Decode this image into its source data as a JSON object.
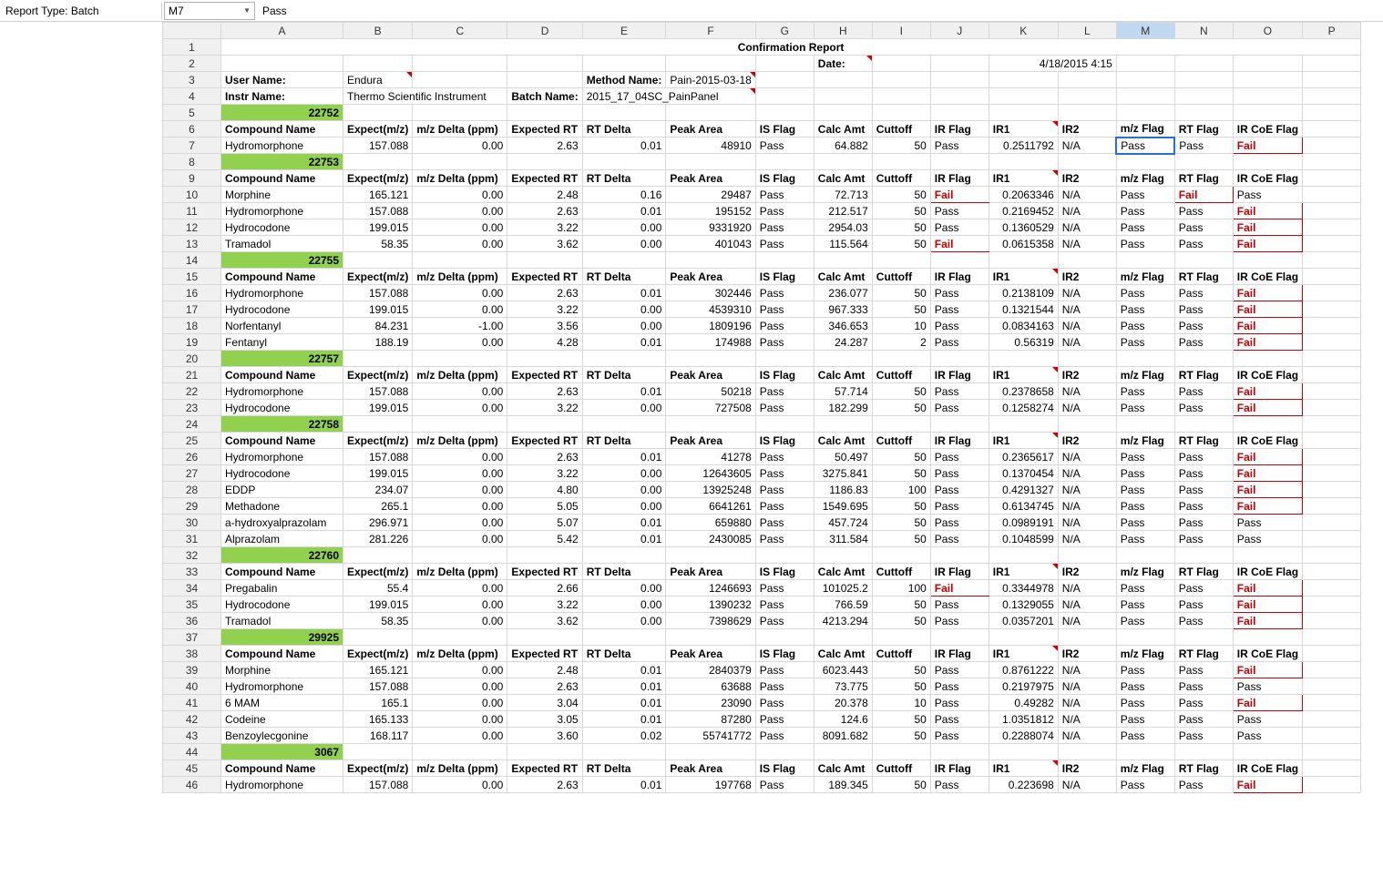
{
  "toprow": {
    "reporttype_label": "Report Type: Batch",
    "namebox": "M7",
    "formula": "Pass"
  },
  "cols": [
    "",
    "A",
    "B",
    "C",
    "D",
    "E",
    "F",
    "G",
    "H",
    "I",
    "J",
    "K",
    "L",
    "M",
    "N",
    "O",
    "P"
  ],
  "title": "Confirmation Report",
  "dateLabel": "Date:",
  "dateVal": "4/18/2015 4:15",
  "userLabel": "User Name:",
  "userVal": "Endura",
  "methodLabel": "Method Name:",
  "methodVal": "Pain-2015-03-18",
  "instrLabel": "Instr Name:",
  "instrVal": "Thermo Scientific Instrument",
  "batchLabel": "Batch Name:",
  "batchVal": "2015_17_04SC_PainPanel",
  "hdr": [
    "Compound Name",
    "Expect(m/z)",
    "m/z Delta (ppm)",
    "Expected RT",
    "RT Delta",
    "Peak Area",
    "IS Flag",
    "Calc Amt",
    "Cuttoff",
    "IR Flag",
    "IR1",
    "IR2",
    "m/z Flag",
    "RT Flag",
    "IR CoE Flag"
  ],
  "chart_data": {
    "type": "table",
    "note": "spreadsheet data rendered from groups below"
  },
  "groups": [
    {
      "id": "22752",
      "rows": [
        [
          "Hydromorphone",
          "157.088",
          "0.00",
          "2.63",
          "0.01",
          "48910",
          "Pass",
          "64.882",
          "50",
          "Pass",
          "0.2511792",
          "N/A",
          "Pass",
          "Pass",
          "Fail"
        ]
      ]
    },
    {
      "id": "22753",
      "rows": [
        [
          "Morphine",
          "165.121",
          "0.00",
          "2.48",
          "0.16",
          "29487",
          "Pass",
          "72.713",
          "50",
          "Fail",
          "0.2063346",
          "N/A",
          "Pass",
          "Fail",
          "Pass"
        ],
        [
          "Hydromorphone",
          "157.088",
          "0.00",
          "2.63",
          "0.01",
          "195152",
          "Pass",
          "212.517",
          "50",
          "Pass",
          "0.2169452",
          "N/A",
          "Pass",
          "Pass",
          "Fail"
        ],
        [
          "Hydrocodone",
          "199.015",
          "0.00",
          "3.22",
          "0.00",
          "9331920",
          "Pass",
          "2954.03",
          "50",
          "Pass",
          "0.1360529",
          "N/A",
          "Pass",
          "Pass",
          "Fail"
        ],
        [
          "Tramadol",
          "58.35",
          "0.00",
          "3.62",
          "0.00",
          "401043",
          "Pass",
          "115.564",
          "50",
          "Fail",
          "0.0615358",
          "N/A",
          "Pass",
          "Pass",
          "Fail"
        ]
      ]
    },
    {
      "id": "22755",
      "rows": [
        [
          "Hydromorphone",
          "157.088",
          "0.00",
          "2.63",
          "0.01",
          "302446",
          "Pass",
          "236.077",
          "50",
          "Pass",
          "0.2138109",
          "N/A",
          "Pass",
          "Pass",
          "Fail"
        ],
        [
          "Hydrocodone",
          "199.015",
          "0.00",
          "3.22",
          "0.00",
          "4539310",
          "Pass",
          "967.333",
          "50",
          "Pass",
          "0.1321544",
          "N/A",
          "Pass",
          "Pass",
          "Fail"
        ],
        [
          "Norfentanyl",
          "84.231",
          "-1.00",
          "3.56",
          "0.00",
          "1809196",
          "Pass",
          "346.653",
          "10",
          "Pass",
          "0.0834163",
          "N/A",
          "Pass",
          "Pass",
          "Fail"
        ],
        [
          "Fentanyl",
          "188.19",
          "0.00",
          "4.28",
          "0.01",
          "174988",
          "Pass",
          "24.287",
          "2",
          "Pass",
          "0.56319",
          "N/A",
          "Pass",
          "Pass",
          "Fail"
        ]
      ]
    },
    {
      "id": "22757",
      "rows": [
        [
          "Hydromorphone",
          "157.088",
          "0.00",
          "2.63",
          "0.01",
          "50218",
          "Pass",
          "57.714",
          "50",
          "Pass",
          "0.2378658",
          "N/A",
          "Pass",
          "Pass",
          "Fail"
        ],
        [
          "Hydrocodone",
          "199.015",
          "0.00",
          "3.22",
          "0.00",
          "727508",
          "Pass",
          "182.299",
          "50",
          "Pass",
          "0.1258274",
          "N/A",
          "Pass",
          "Pass",
          "Fail"
        ]
      ]
    },
    {
      "id": "22758",
      "rows": [
        [
          "Hydromorphone",
          "157.088",
          "0.00",
          "2.63",
          "0.01",
          "41278",
          "Pass",
          "50.497",
          "50",
          "Pass",
          "0.2365617",
          "N/A",
          "Pass",
          "Pass",
          "Fail"
        ],
        [
          "Hydrocodone",
          "199.015",
          "0.00",
          "3.22",
          "0.00",
          "12643605",
          "Pass",
          "3275.841",
          "50",
          "Pass",
          "0.1370454",
          "N/A",
          "Pass",
          "Pass",
          "Fail"
        ],
        [
          "EDDP",
          "234.07",
          "0.00",
          "4.80",
          "0.00",
          "13925248",
          "Pass",
          "1186.83",
          "100",
          "Pass",
          "0.4291327",
          "N/A",
          "Pass",
          "Pass",
          "Fail"
        ],
        [
          "Methadone",
          "265.1",
          "0.00",
          "5.05",
          "0.00",
          "6641261",
          "Pass",
          "1549.695",
          "50",
          "Pass",
          "0.6134745",
          "N/A",
          "Pass",
          "Pass",
          "Fail"
        ],
        [
          "a-hydroxyalprazolam",
          "296.971",
          "0.00",
          "5.07",
          "0.01",
          "659880",
          "Pass",
          "457.724",
          "50",
          "Pass",
          "0.0989191",
          "N/A",
          "Pass",
          "Pass",
          "Pass"
        ],
        [
          "Alprazolam",
          "281.226",
          "0.00",
          "5.42",
          "0.01",
          "2430085",
          "Pass",
          "311.584",
          "50",
          "Pass",
          "0.1048599",
          "N/A",
          "Pass",
          "Pass",
          "Pass"
        ]
      ]
    },
    {
      "id": "22760",
      "rows": [
        [
          "Pregabalin",
          "55.4",
          "0.00",
          "2.66",
          "0.00",
          "1246693",
          "Pass",
          "101025.2",
          "100",
          "Fail",
          "0.3344978",
          "N/A",
          "Pass",
          "Pass",
          "Fail"
        ],
        [
          "Hydrocodone",
          "199.015",
          "0.00",
          "3.22",
          "0.00",
          "1390232",
          "Pass",
          "766.59",
          "50",
          "Pass",
          "0.1329055",
          "N/A",
          "Pass",
          "Pass",
          "Fail"
        ],
        [
          "Tramadol",
          "58.35",
          "0.00",
          "3.62",
          "0.00",
          "7398629",
          "Pass",
          "4213.294",
          "50",
          "Pass",
          "0.0357201",
          "N/A",
          "Pass",
          "Pass",
          "Fail"
        ]
      ]
    },
    {
      "id": "29925",
      "rows": [
        [
          "Morphine",
          "165.121",
          "0.00",
          "2.48",
          "0.01",
          "2840379",
          "Pass",
          "6023.443",
          "50",
          "Pass",
          "0.8761222",
          "N/A",
          "Pass",
          "Pass",
          "Fail"
        ],
        [
          "Hydromorphone",
          "157.088",
          "0.00",
          "2.63",
          "0.01",
          "63688",
          "Pass",
          "73.775",
          "50",
          "Pass",
          "0.2197975",
          "N/A",
          "Pass",
          "Pass",
          "Pass"
        ],
        [
          "6 MAM",
          "165.1",
          "0.00",
          "3.04",
          "0.01",
          "23090",
          "Pass",
          "20.378",
          "10",
          "Pass",
          "0.49282",
          "N/A",
          "Pass",
          "Pass",
          "Fail"
        ],
        [
          "Codeine",
          "165.133",
          "0.00",
          "3.05",
          "0.01",
          "87280",
          "Pass",
          "124.6",
          "50",
          "Pass",
          "1.0351812",
          "N/A",
          "Pass",
          "Pass",
          "Pass"
        ],
        [
          "Benzoylecgonine",
          "168.117",
          "0.00",
          "3.60",
          "0.02",
          "55741772",
          "Pass",
          "8091.682",
          "50",
          "Pass",
          "0.2288074",
          "N/A",
          "Pass",
          "Pass",
          "Pass"
        ]
      ]
    },
    {
      "id": "3067",
      "rows": [
        [
          "Hydromorphone",
          "157.088",
          "0.00",
          "2.63",
          "0.01",
          "197768",
          "Pass",
          "189.345",
          "50",
          "Pass",
          "0.223698",
          "N/A",
          "Pass",
          "Pass",
          "Fail"
        ]
      ]
    }
  ]
}
